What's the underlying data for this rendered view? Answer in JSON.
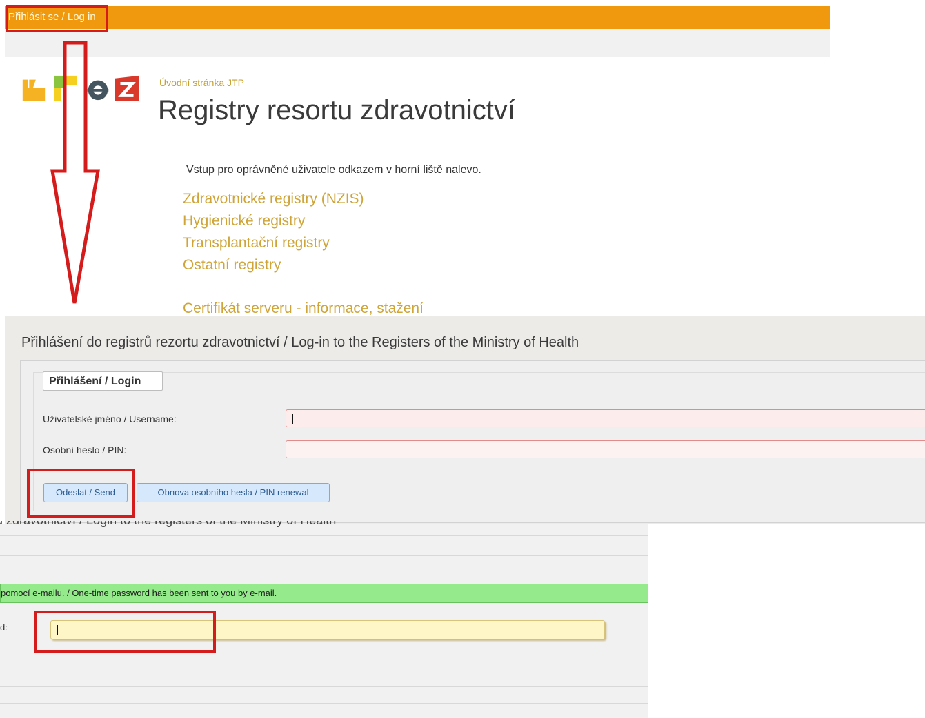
{
  "topbar": {
    "login_link": "Přihlásit se / Log in"
  },
  "landing": {
    "breadcrumb": "Úvodní stránka JTP",
    "title": "Registry resortu zdravotnictví",
    "intro": "Vstup pro oprávněné uživatele odkazem v horní liště nalevo.",
    "links": [
      "Zdravotnické registry (NZIS)",
      "Hygienické registry",
      "Transplantační registry",
      "Ostatní registry"
    ],
    "certificate_link": "Certifikát serveru - informace, stažení"
  },
  "login": {
    "title": "Přihlášení do registrů rezortu zdravotnictví / Log-in to the Registers of the Ministry of Health",
    "legend": "Přihlášení / Login",
    "username_label": "Uživatelské jméno / Username:",
    "pin_label": "Osobní heslo / PIN:",
    "send_button": "Odeslat / Send",
    "renew_button": "Obnova osobního hesla / PIN renewal"
  },
  "otp": {
    "cut_title": "rů zdravotnictví / Login to the registers of the Ministry of Health",
    "message": "pomocí e-mailu. / One-time password has been sent to you by e-mail.",
    "field_label": "d:"
  },
  "colors": {
    "topbar": "#f0980e",
    "link_gold": "#cfa53a",
    "annotation_red": "#d41c1c",
    "success_green": "#95ea8b",
    "otp_input_yellow": "#fff6c8",
    "error_input_pink": "#fdecec",
    "button_blue": "#d6e8fb"
  },
  "icons": {
    "logo": "uzis-logo",
    "arrow": "down-arrow-annotation"
  }
}
